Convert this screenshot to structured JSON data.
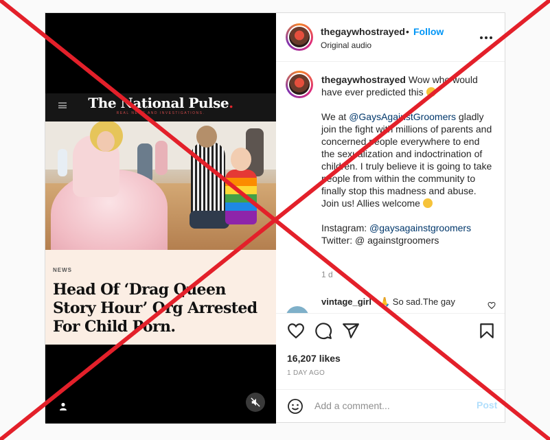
{
  "post": {
    "media": {
      "publication_name": "The National Pulse",
      "publication_tagline": "REAL NEWS AND INVESTIGATIONS.",
      "article_kicker": "NEWS",
      "article_headline": "Head Of ‘Drag Queen Story Hour’ Org Arrested For Child Porn."
    },
    "header": {
      "username": "thegaywhostrayed",
      "separator": "•",
      "follow_label": "Follow",
      "audio_label": "Original audio"
    },
    "caption": {
      "username": "thegaywhostrayed",
      "line1": "Wow who would have ever predicted this",
      "para2_pre": "We at ",
      "para2_mention": "@GaysAgainstGroomers",
      "para2_post": " gladly join the fight with millions of parents and concerned people everywhere to end the sexualization and indoctrination of children. I truly believe it is going to take people from within the community to finally stop this madness and abuse. Join us! Allies welcome",
      "instagram_label": "Instagram: ",
      "instagram_handle": "@gaysagainstgroomers",
      "twitter_line": "Twitter: @ againstgroomers",
      "time_ago": "1 d"
    },
    "first_comment": {
      "username": "vintage_girl",
      "text": "🙏 So sad.The gay"
    },
    "likes": "16,207 likes",
    "posted_ago": "1 DAY AGO",
    "comment_box": {
      "placeholder": "Add a comment...",
      "post_label": "Post"
    }
  },
  "colors": {
    "overlay_x": "#e3202a",
    "link_blue": "#0095f6",
    "mention_blue": "#00376b"
  },
  "icons": [
    "more-options-icon",
    "heart-icon",
    "comment-icon",
    "share-icon",
    "bookmark-icon",
    "emoji-icon",
    "profile-icon",
    "muted-icon"
  ]
}
